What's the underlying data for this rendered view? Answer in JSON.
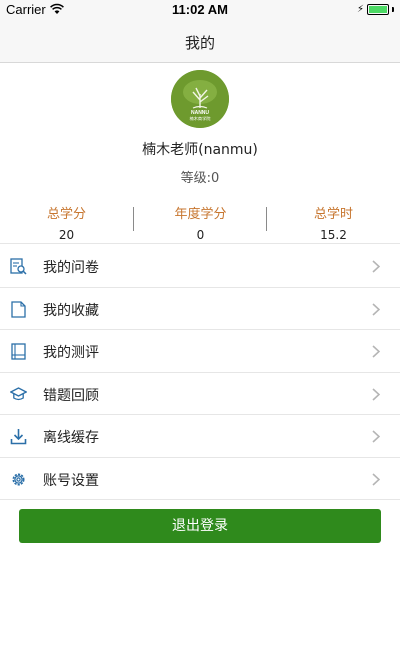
{
  "status_bar": {
    "carrier": "Carrier",
    "time": "11:02 AM",
    "battery_level": 1.0,
    "wifi_icon": "wifi-icon",
    "charging_icon": "charging-bolt-icon"
  },
  "nav": {
    "title": "我的"
  },
  "profile": {
    "avatar_text_top": "NANNU",
    "avatar_text_bottom": "楠木商学院",
    "name": "楠木老师(nanmu)",
    "level": "等级:0"
  },
  "stats": [
    {
      "label": "总学分",
      "value": "20"
    },
    {
      "label": "年度学分",
      "value": "0"
    },
    {
      "label": "总学时",
      "value": "15.2"
    }
  ],
  "menu": [
    {
      "label": "我的问卷",
      "icon": "questionnaire-search-icon"
    },
    {
      "label": "我的收藏",
      "icon": "document-icon"
    },
    {
      "label": "我的测评",
      "icon": "book-icon"
    },
    {
      "label": "错题回顾",
      "icon": "graduation-cap-icon"
    },
    {
      "label": "离线缓存",
      "icon": "download-icon"
    },
    {
      "label": "账号设置",
      "icon": "gear-icon"
    }
  ],
  "logout": {
    "label": "退出登录"
  },
  "colors": {
    "accent_green": "#2f8a1c",
    "stat_label_orange": "#c7762f",
    "icon_blue": "#2b6fa8"
  }
}
